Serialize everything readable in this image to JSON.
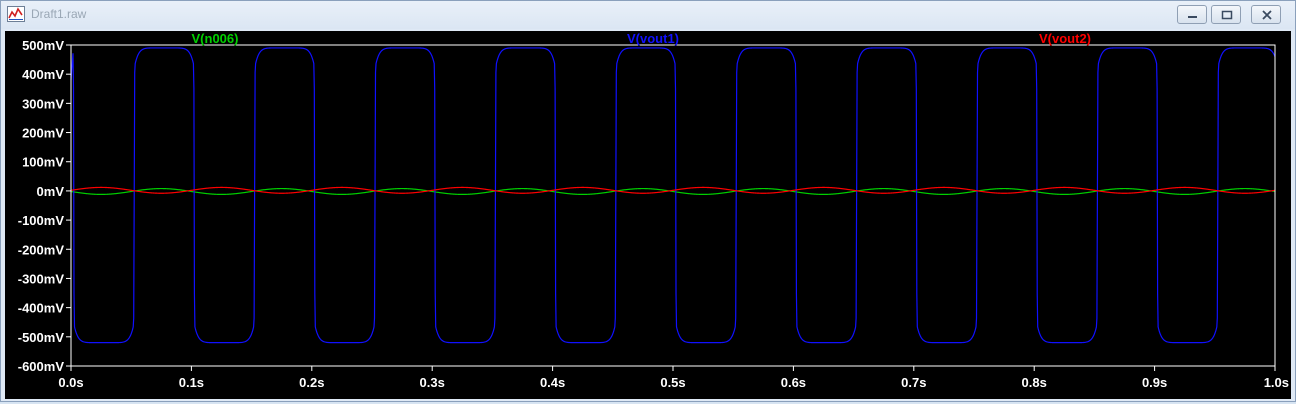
{
  "window": {
    "title": "Draft1.raw",
    "controls": [
      "minimize",
      "restore",
      "close"
    ]
  },
  "chart_data": {
    "type": "line",
    "xlabel": "",
    "ylabel": "",
    "xlim": [
      0,
      1.0
    ],
    "ylim": [
      -600,
      500
    ],
    "x_tick_labels": [
      "0.0s",
      "0.1s",
      "0.2s",
      "0.3s",
      "0.4s",
      "0.5s",
      "0.6s",
      "0.7s",
      "0.8s",
      "0.9s",
      "1.0s"
    ],
    "x_ticks": [
      0,
      0.1,
      0.2,
      0.3,
      0.4,
      0.5,
      0.6,
      0.7,
      0.8,
      0.9,
      1.0
    ],
    "y_tick_labels": [
      "500mV",
      "400mV",
      "300mV",
      "200mV",
      "100mV",
      "0mV",
      "-100mV",
      "-200mV",
      "-300mV",
      "-400mV",
      "-500mV",
      "-600mV"
    ],
    "y_ticks": [
      500,
      400,
      300,
      200,
      100,
      0,
      -100,
      -200,
      -300,
      -400,
      -500,
      -600
    ],
    "legend_placement": "top",
    "series": [
      {
        "name": "V(n006)",
        "color": "#00d000",
        "waveform": "sine",
        "period_s": 0.1,
        "amplitude_mV": 10,
        "offset_mV": -2,
        "phase_deg": 180
      },
      {
        "name": "V(vout1)",
        "color": "#1010ff",
        "waveform": "clipped-square",
        "period_s": 0.1,
        "high_mV": 490,
        "low_mV": -520,
        "start_mV": 380
      },
      {
        "name": "V(vout2)",
        "color": "#ff0000",
        "waveform": "sine",
        "period_s": 0.1,
        "amplitude_mV": 10,
        "offset_mV": 2,
        "phase_deg": 0
      }
    ],
    "background": "#000000",
    "axis_color": "#ffffff"
  }
}
